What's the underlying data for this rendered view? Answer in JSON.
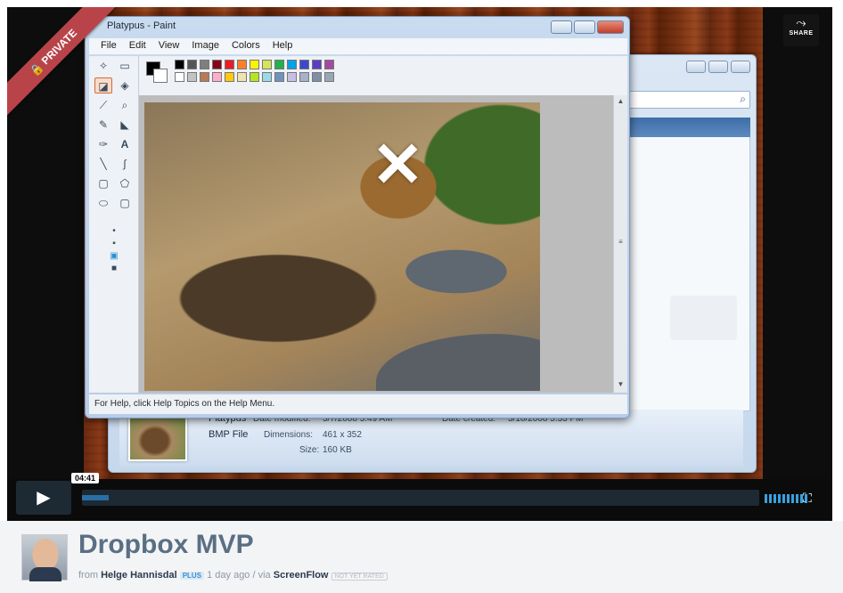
{
  "player": {
    "ribbon_label": "PRIVATE",
    "share_label": "SHARE",
    "timecode": "04:41",
    "progress_fraction": 0.04
  },
  "paint": {
    "title": "Platypus - Paint",
    "menu": [
      "File",
      "Edit",
      "View",
      "Image",
      "Colors",
      "Help"
    ],
    "status": "For Help, click Help Topics on the Help Menu.",
    "palette_top": [
      "#000000",
      "#555555",
      "#7f7f7f",
      "#880015",
      "#ed1c24",
      "#ff7f27",
      "#fff200",
      "#d7e35a",
      "#22b14c",
      "#00a2e8",
      "#3f48cc",
      "#5a3ec8",
      "#a349a4"
    ],
    "palette_bottom": [
      "#ffffff",
      "#c3c3c3",
      "#b97a57",
      "#ffaec9",
      "#ffc90e",
      "#efe4b0",
      "#b5e61d",
      "#99d9ea",
      "#7092be",
      "#c8bfe7",
      "#a4b3c8",
      "#7f8fa6",
      "#9aa6b8"
    ]
  },
  "explorer": {
    "file_name": "Platypus",
    "file_type": "BMP File",
    "date_modified_label": "Date modified:",
    "date_modified": "3/7/2008 5:49 AM",
    "dimensions_label": "Dimensions:",
    "dimensions": "461 x 352",
    "size_label": "Size:",
    "size": "160 KB",
    "date_created_label": "Date created:",
    "date_created": "3/10/2008 5:33 PM"
  },
  "video": {
    "title": "Dropbox MVP",
    "from_label": "from",
    "author": "Helge Hannisdal",
    "badge": "PLUS",
    "posted": "1 day ago",
    "via_label": "/ via",
    "app": "ScreenFlow",
    "rating": "NOT YET RATED"
  }
}
